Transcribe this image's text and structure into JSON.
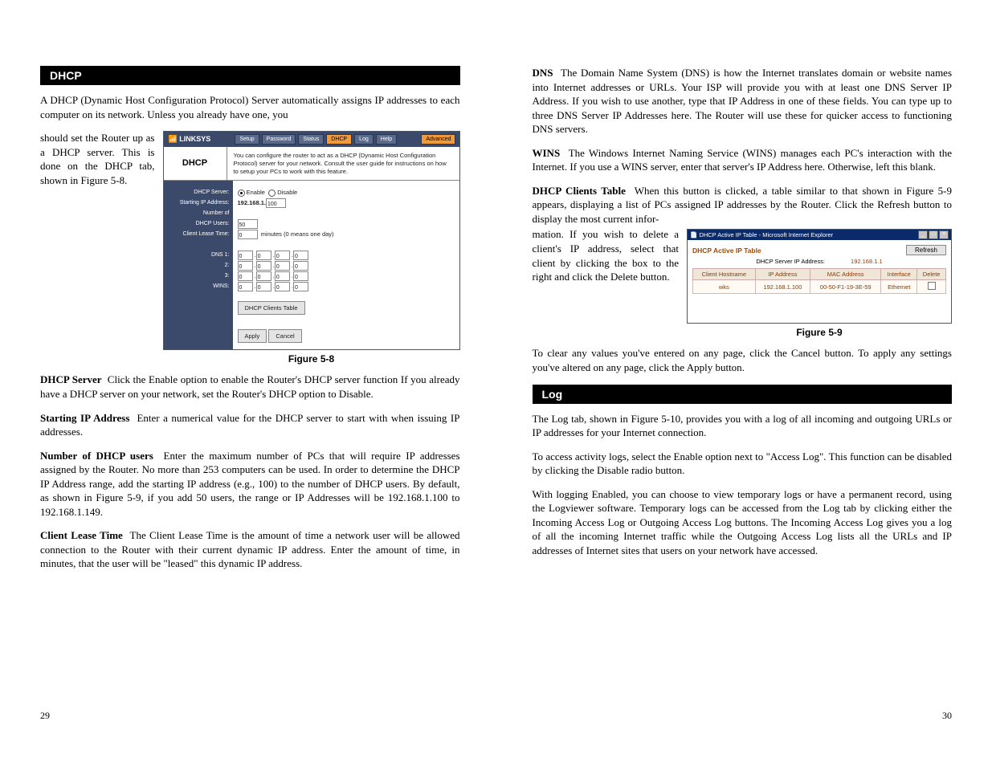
{
  "left": {
    "section": "DHCP",
    "intro": "A DHCP (Dynamic Host Configuration Protocol) Server automatically assigns IP addresses to each computer on its network. Unless you already have one, you",
    "wrap_text": "should set the Router up as a DHCP server. This is done on the DHCP tab, shown in Figure 5-8.",
    "fig58": {
      "brand": "LINKSYS",
      "tabs": [
        "Setup",
        "Password",
        "Status",
        "DHCP",
        "Log",
        "Help"
      ],
      "adv": "Advanced",
      "title": "DHCP",
      "desc": "You can configure the router to act as a DHCP (Dynamic Host Configuration Protocol) server for your network. Consult the user guide for instructions on how to setup your PCs to work with this feature.",
      "labels": {
        "server": "DHCP Server:",
        "start": "Starting IP Address:",
        "num1": "Number of",
        "num2": "DHCP Users:",
        "lease": "Client Lease Time:",
        "dns1": "DNS 1:",
        "dns2": "2:",
        "dns3": "3:",
        "wins": "WINS:"
      },
      "enable": "Enable",
      "disable": "Disable",
      "ip_prefix": "192.168.1.",
      "ip_last": "100",
      "users": "50",
      "lease_val": "0",
      "lease_suffix": "minutes (0 means one day)",
      "clients_btn": "DHCP Clients Table",
      "apply": "Apply",
      "cancel": "Cancel",
      "caption": "Figure 5-8"
    },
    "p_server": "Click the Enable option to enable the Router's DHCP server function If you already have a DHCP server on your network, set the Router's DHCP option to Disable.",
    "p_start": "Enter a numerical value for the DHCP server to start with when issuing IP addresses.",
    "p_num": "Enter the maximum number of PCs that will require IP addresses assigned by the Router. No more than 253 computers can be used.  In order to determine the DHCP IP Address range, add the starting IP address (e.g., 100) to the number of DHCP users.  By default, as shown in Figure 5-9, if you add 50 users, the range or IP Addresses will be 192.168.1.100 to 192.168.1.149.",
    "p_lease": "The Client Lease Time is the amount of time a network user will be allowed connection to the Router with their current dynamic IP address. Enter the amount of time, in minutes, that the user will be \"leased\" this dynamic IP address.",
    "hdr_server": "DHCP Server",
    "hdr_start": "Starting IP Address",
    "hdr_num": "Number of DHCP users",
    "hdr_lease": "Client Lease Time",
    "page_num": "29"
  },
  "right": {
    "p_dns": "The Domain Name System (DNS) is how the Internet translates domain or website names into Internet addresses or URLs. Your ISP will provide you with at least one DNS Server IP Address. If you wish to use another, type that IP Address in one of these fields. You can type up to three DNS Server IP Addresses here. The Router will use these for quicker access to functioning DNS servers.",
    "p_wins": "The Windows Internet Naming Service (WINS) manages each PC's interaction with the Internet. If you use a WINS server, enter that server's IP Address here. Otherwise, left this blank.",
    "p_clients": "When this button is clicked, a table similar to that shown in Figure 5-9 appears, displaying a list of PCs assigned IP addresses by the Router. Click the Refresh button to display the most current infor-",
    "wrap_text": "mation. If you wish to delete a client's IP address, select that client by clicking the box to the right and click the Delete button.",
    "hdr_dns": "DNS",
    "hdr_wins": "WINS",
    "hdr_clients": "DHCP Clients Table",
    "fig59": {
      "win_title": "DHCP Active IP Table - Microsoft Internet Explorer",
      "title": "DHCP Active IP Table",
      "refresh": "Refresh",
      "srv_label": "DHCP Server IP Address:",
      "srv_ip": "192.168.1.1",
      "cols": [
        "Client Hostname",
        "IP Address",
        "MAC Address",
        "Interface",
        "Delete"
      ],
      "row": [
        "wks",
        "192.168.1.100",
        "00-50-F1-19-3E-59",
        "Ethernet"
      ],
      "caption": "Figure 5-9"
    },
    "p_clear": "To clear any values you've entered on any page, click the Cancel button.  To apply any settings you've altered on any page, click the Apply button.",
    "section": "Log",
    "p_log1": "The Log tab, shown in Figure 5-10, provides you with a log of all incoming and outgoing URLs or IP addresses for your Internet connection.",
    "p_log2": "To access activity logs, select the Enable option next to \"Access Log\". This function can be disabled by clicking the Disable radio button.",
    "p_log3": "With logging Enabled, you can choose to view temporary logs or have a permanent record, using the Logviewer software.  Temporary logs can be accessed from the Log tab by clicking either the Incoming Access Log or Outgoing Access Log buttons.  The Incoming Access Log gives you a log of all the incoming Internet traffic while the Outgoing Access Log lists all the URLs and IP addresses of Internet sites that users on your network have accessed.",
    "page_num": "30"
  }
}
